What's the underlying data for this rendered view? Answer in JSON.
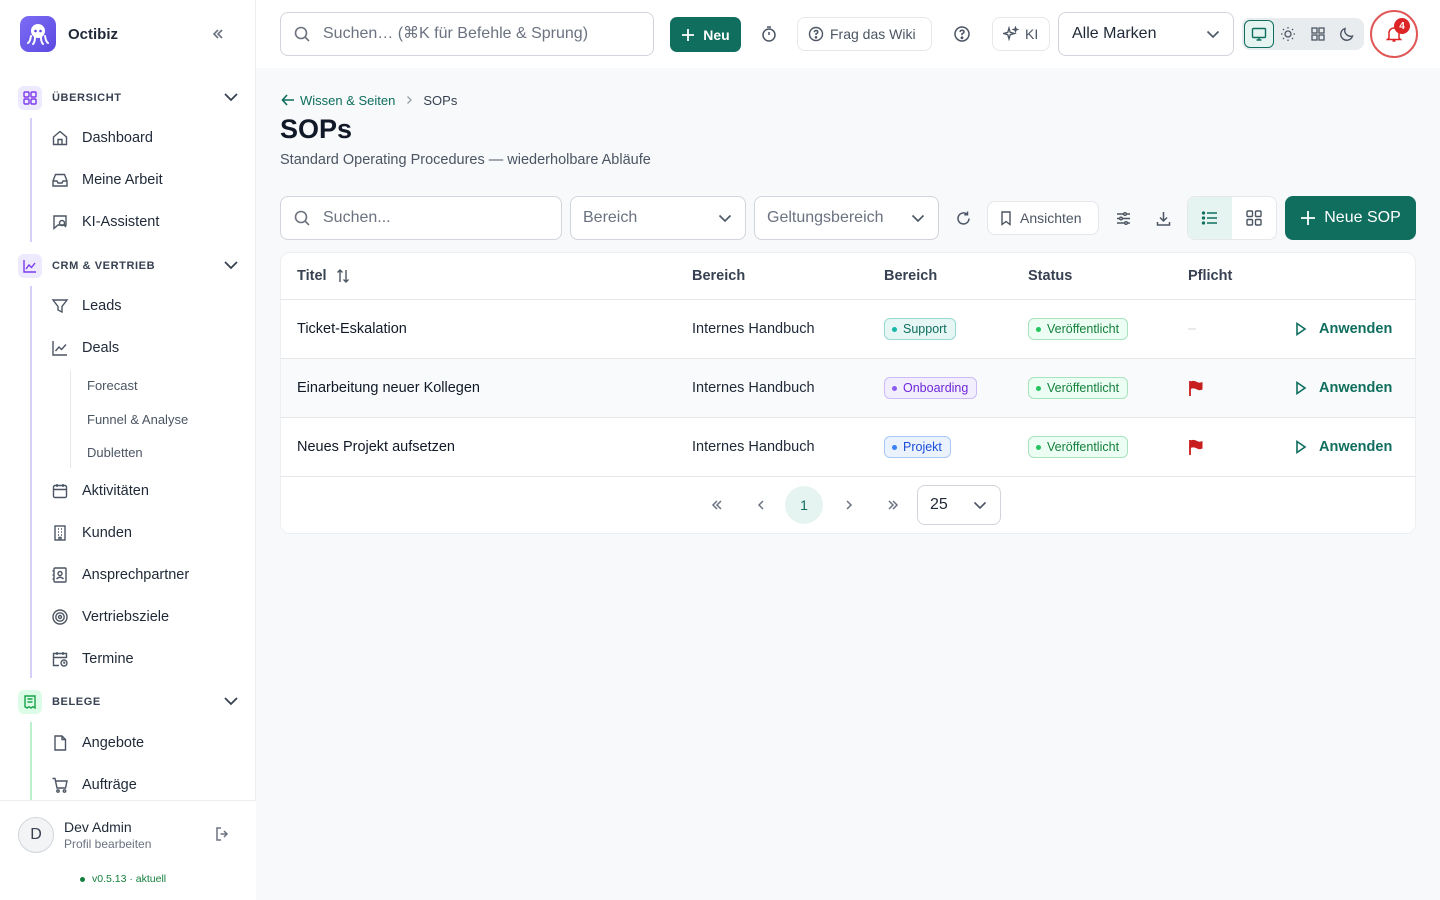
{
  "app": {
    "name": "Octibiz"
  },
  "sidebar": {
    "sections": [
      {
        "label": "ÜBERSICHT"
      },
      {
        "label": "CRM & VERTRIEB"
      },
      {
        "label": "BELEGE"
      }
    ],
    "overview_items": [
      "Dashboard",
      "Meine Arbeit",
      "KI-Assistent"
    ],
    "crm_items": [
      "Leads",
      "Deals",
      "Aktivitäten",
      "Kunden",
      "Ansprechpartner",
      "Vertriebsziele",
      "Termine"
    ],
    "deals_sub": [
      "Forecast",
      "Funnel & Analyse",
      "Dubletten"
    ],
    "belege_items": [
      "Angebote",
      "Aufträge"
    ],
    "user": {
      "initial": "D",
      "name": "Dev Admin",
      "sub": "Profil bearbeiten"
    },
    "version": "v0.5.13 · aktuell"
  },
  "topbar": {
    "search_placeholder": "Suchen… (⌘K für Befehle & Sprung)",
    "new_label": "Neu",
    "wiki_label": "Frag das Wiki",
    "ai_label": "KI",
    "brand_select": "Alle Marken",
    "notifications": "4"
  },
  "page": {
    "breadcrumb_parent": "Wissen & Seiten",
    "breadcrumb_current": "SOPs",
    "title": "SOPs",
    "subtitle": "Standard Operating Procedures — wiederholbare Abläufe"
  },
  "filters": {
    "search_placeholder": "Suchen...",
    "area_placeholder": "Bereich",
    "scope_placeholder": "Geltungsbereich",
    "views_label": "Ansichten",
    "new_sop_label": "Neue SOP"
  },
  "table": {
    "headers": [
      "Titel",
      "Bereich",
      "Bereich",
      "Status",
      "Pflicht"
    ],
    "apply_label": "Anwenden",
    "rows": [
      {
        "title": "Ticket-Eskalation",
        "scope": "Internes Handbuch",
        "area": "Support",
        "status": "Veröffentlicht",
        "mandatory": "–"
      },
      {
        "title": "Einarbeitung neuer Kollegen",
        "scope": "Internes Handbuch",
        "area": "Onboarding",
        "status": "Veröffentlicht",
        "mandatory": "flag"
      },
      {
        "title": "Neues Projekt aufsetzen",
        "scope": "Internes Handbuch",
        "area": "Projekt",
        "status": "Veröffentlicht",
        "mandatory": "flag"
      }
    ]
  },
  "pagination": {
    "current_page": "1",
    "per_page": "25"
  },
  "colors": {
    "accent": "#0f6e5e",
    "danger": "#dc2626"
  }
}
